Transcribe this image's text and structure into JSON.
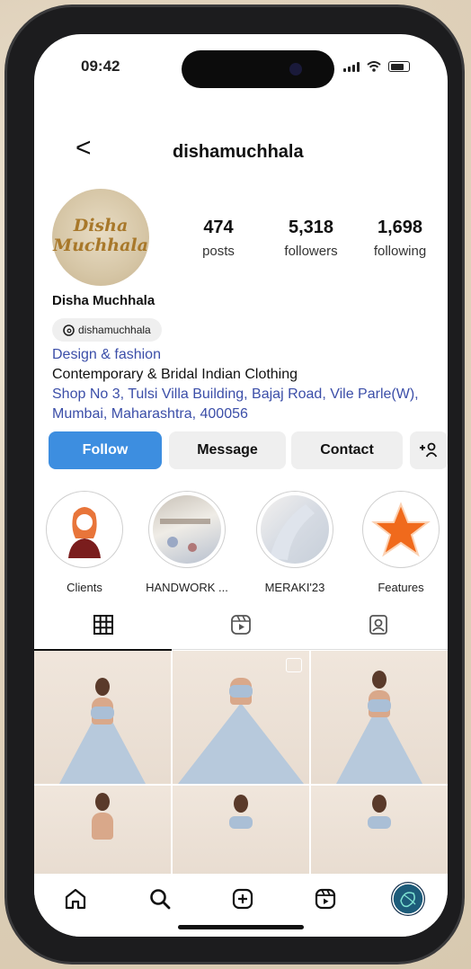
{
  "status": {
    "time": "09:42"
  },
  "header": {
    "back": "<",
    "username": "dishamuchhala"
  },
  "profile": {
    "avatar_line1": "Disha",
    "avatar_line2": "Muchhala",
    "stats": [
      {
        "value": "474",
        "label": "posts"
      },
      {
        "value": "5,318",
        "label": "followers"
      },
      {
        "value": "1,698",
        "label": "following"
      }
    ],
    "name": "Disha Muchhala",
    "threads_handle": "dishamuchhala",
    "category": "Design & fashion",
    "bio": "Contemporary & Bridal Indian Clothing",
    "address": "Shop No 3, Tulsi Villa Building, Bajaj Road, Vile Parle(W), Mumbai, Maharashtra, 400056"
  },
  "buttons": {
    "follow": "Follow",
    "message": "Message",
    "contact": "Contact",
    "add_user": "+♖"
  },
  "highlights": [
    {
      "label": "Clients"
    },
    {
      "label": "HANDWORK ..."
    },
    {
      "label": "MERAKI'23"
    },
    {
      "label": "Features"
    }
  ],
  "colors": {
    "accent": "#3d8ee0",
    "link": "#3b4ea8"
  },
  "tabs": [
    {
      "icon": "grid-icon",
      "active": true
    },
    {
      "icon": "reels-icon",
      "active": false
    },
    {
      "icon": "tagged-icon",
      "active": false
    }
  ],
  "nav": [
    {
      "icon": "home-icon"
    },
    {
      "icon": "search-icon"
    },
    {
      "icon": "create-icon"
    },
    {
      "icon": "reels-icon"
    },
    {
      "icon": "profile-icon"
    }
  ]
}
